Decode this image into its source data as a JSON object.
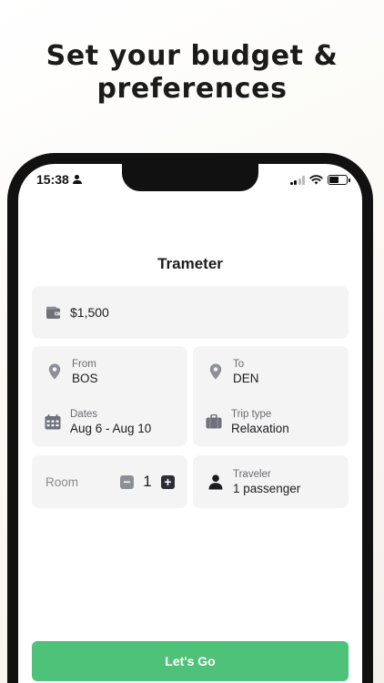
{
  "headline": {
    "line1": "Set your budget &",
    "line2": "preferences"
  },
  "status_bar": {
    "time": "15:38"
  },
  "app": {
    "title": "Trameter"
  },
  "budget": {
    "value": "$1,500",
    "icon": "wallet-icon"
  },
  "route": {
    "from": {
      "label": "From",
      "value": "BOS",
      "icon": "location-pin-icon"
    },
    "to": {
      "label": "To",
      "value": "DEN",
      "icon": "location-pin-icon"
    }
  },
  "dates": {
    "label": "Dates",
    "value": "Aug 6 - Aug 10",
    "icon": "calendar-icon"
  },
  "trip_type": {
    "label": "Trip type",
    "value": "Relaxation",
    "icon": "suitcase-icon"
  },
  "room": {
    "label": "Room",
    "count": "1",
    "minus": "−",
    "plus": "+"
  },
  "traveler": {
    "label": "Traveler",
    "value": "1 passenger",
    "icon": "person-icon"
  },
  "cta": {
    "label": "Let's Go",
    "color": "#4fc27a"
  },
  "colors": {
    "card_bg": "#f4f4f5",
    "accent": "#4fc27a",
    "icon_gray": "#8c8f97"
  }
}
